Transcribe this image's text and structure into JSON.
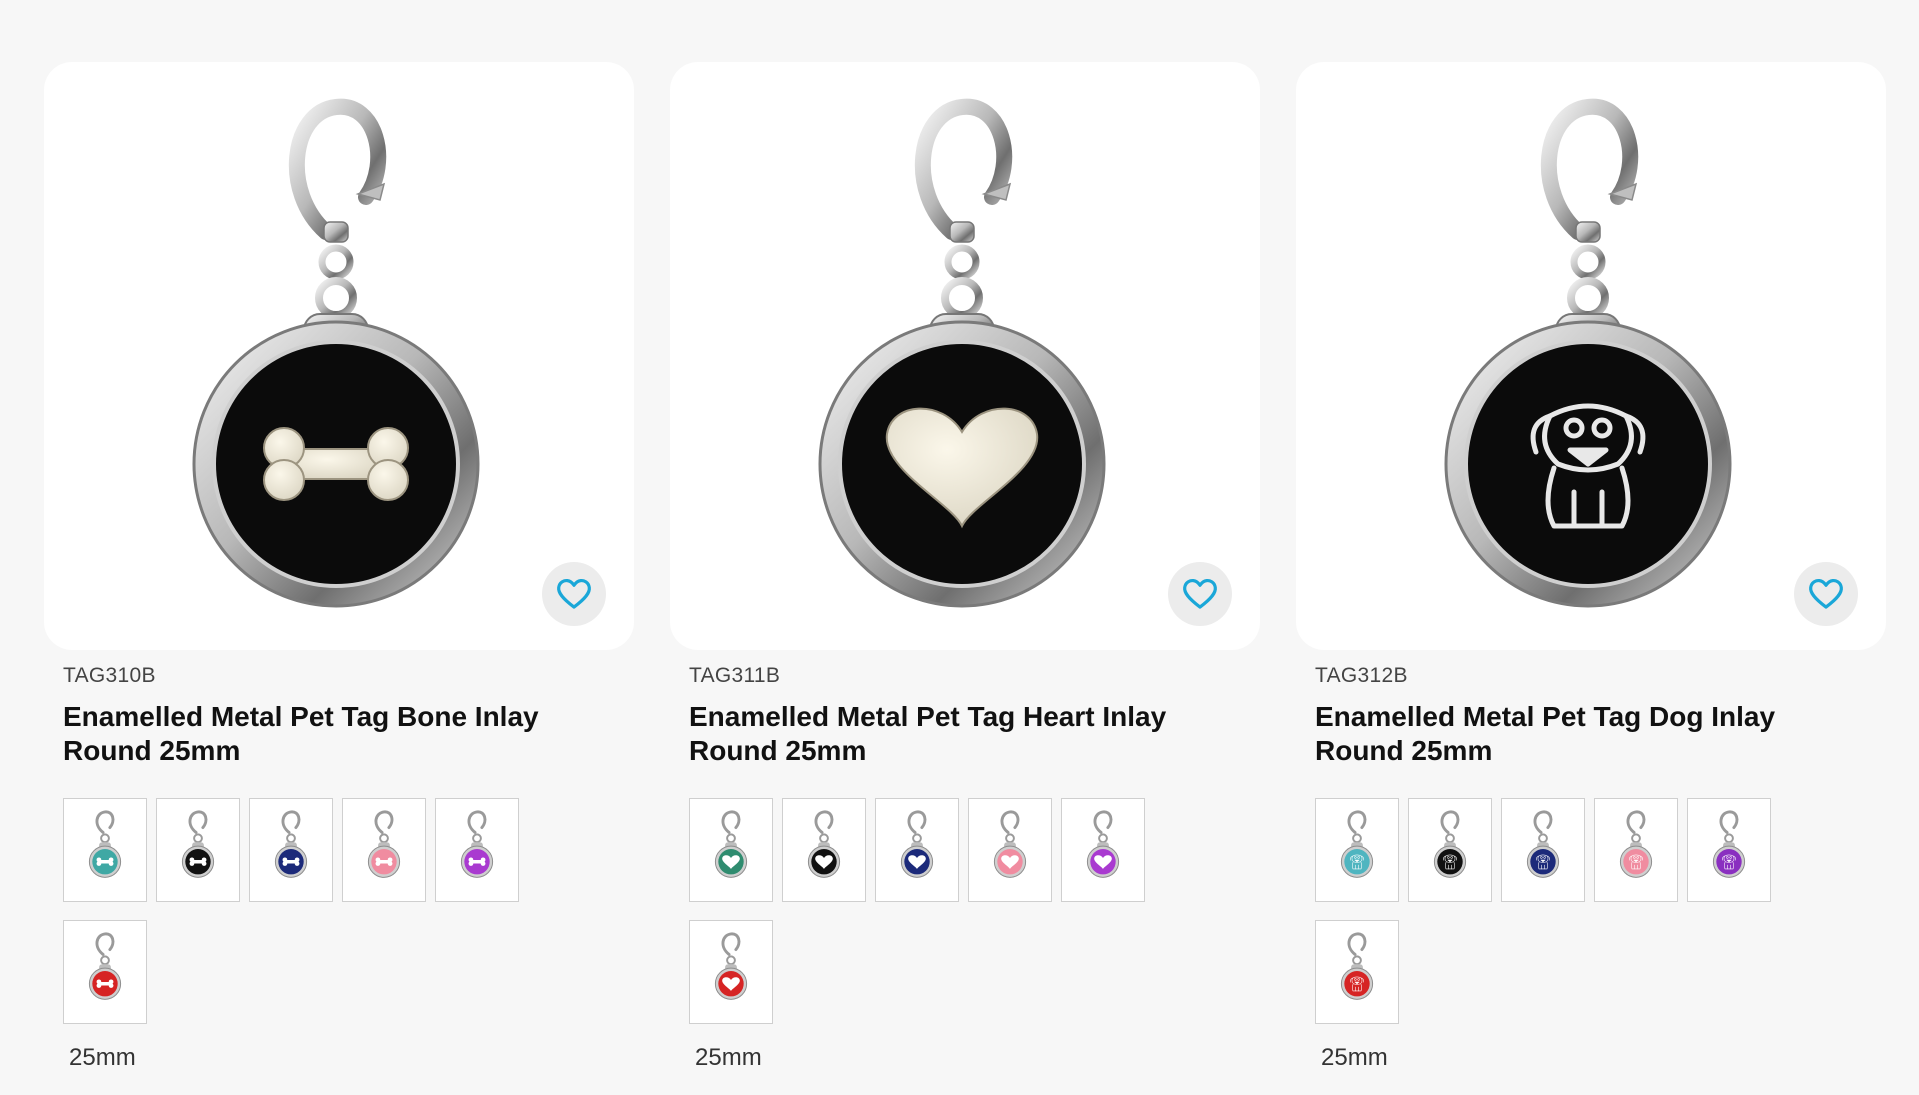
{
  "products": [
    {
      "sku": "TAG310B",
      "title": "Enamelled Metal Pet Tag Bone Inlay Round 25mm",
      "inlay": "bone",
      "size": "25mm",
      "swatches": [
        {
          "color": "#3fa8a4"
        },
        {
          "color": "#111111"
        },
        {
          "color": "#1c2a7a"
        },
        {
          "color": "#f08ca0"
        },
        {
          "color": "#a93ad0"
        },
        {
          "color": "#d62424"
        }
      ]
    },
    {
      "sku": "TAG311B",
      "title": "Enamelled Metal Pet Tag Heart Inlay Round 25mm",
      "inlay": "heart",
      "size": "25mm",
      "swatches": [
        {
          "color": "#2f8c6f"
        },
        {
          "color": "#111111"
        },
        {
          "color": "#1c2a7a"
        },
        {
          "color": "#f08ca0"
        },
        {
          "color": "#a93ad0"
        },
        {
          "color": "#d62424"
        }
      ]
    },
    {
      "sku": "TAG312B",
      "title": "Enamelled Metal Pet Tag Dog Inlay Round 25mm",
      "inlay": "dog",
      "size": "25mm",
      "swatches": [
        {
          "color": "#4fb5c0"
        },
        {
          "color": "#111111"
        },
        {
          "color": "#1c2a7a"
        },
        {
          "color": "#f08ca0"
        },
        {
          "color": "#8a2fc0"
        },
        {
          "color": "#d62424"
        }
      ]
    }
  ],
  "ui": {
    "favorite_icon": "heart-outline-icon",
    "accent_color": "#1aa7d8"
  }
}
